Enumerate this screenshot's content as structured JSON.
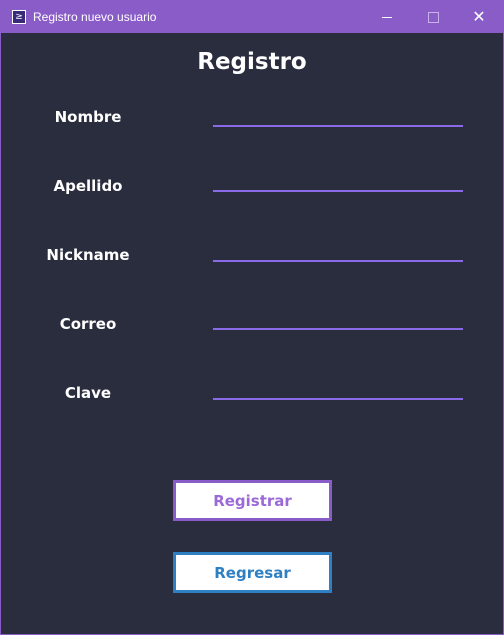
{
  "window": {
    "title": "Registro nuevo usuario",
    "icon": "app-icon",
    "controls": [
      "minimize-icon",
      "maximize-icon",
      "close-icon"
    ]
  },
  "form": {
    "heading": "Registro",
    "fields": [
      {
        "label": "Nombre",
        "value": ""
      },
      {
        "label": "Apellido",
        "value": ""
      },
      {
        "label": "Nickname",
        "value": ""
      },
      {
        "label": "Correo",
        "value": ""
      },
      {
        "label": "Clave",
        "value": ""
      }
    ],
    "register_label": "Registrar",
    "back_label": "Regresar"
  },
  "colors": {
    "titlebar": "#8a5cc7",
    "background": "#2a2d3e",
    "field_underline": "#8a6ae6",
    "register_accent": "#8a5cc7",
    "back_accent": "#2f7fc3"
  }
}
